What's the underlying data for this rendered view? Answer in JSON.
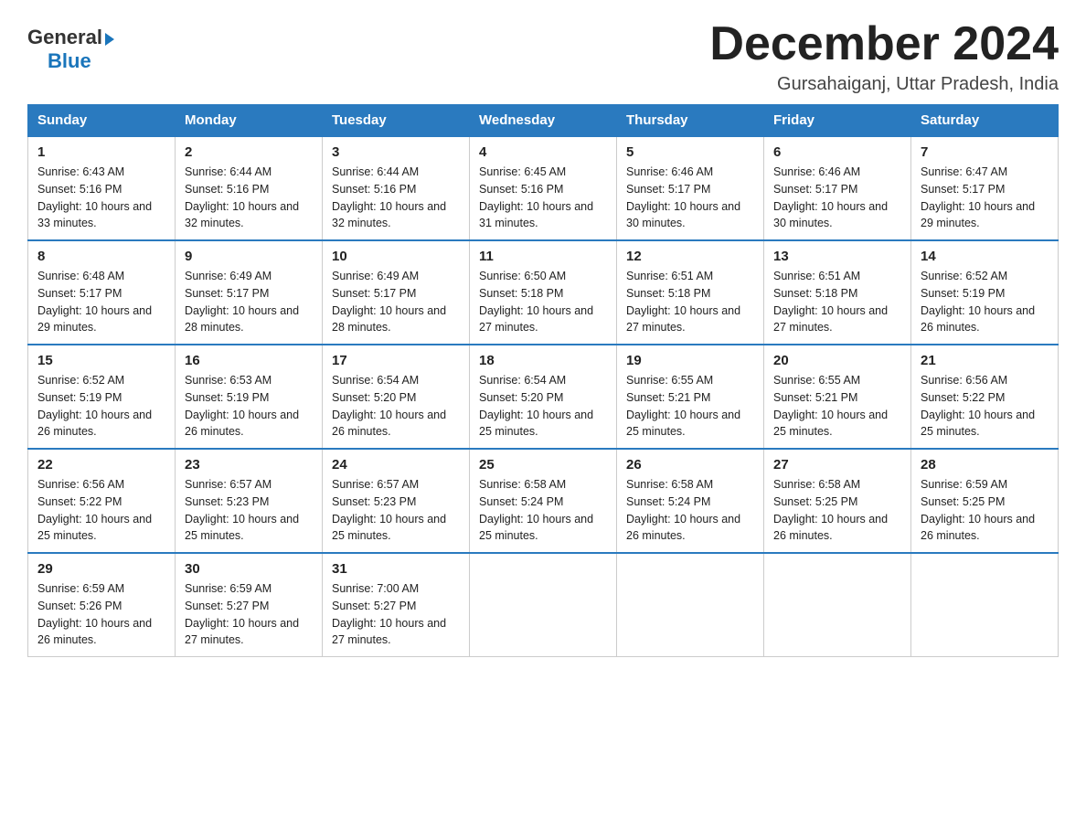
{
  "header": {
    "logo_general": "General",
    "logo_blue": "Blue",
    "title": "December 2024",
    "subtitle": "Gursahaiganj, Uttar Pradesh, India"
  },
  "days_of_week": [
    "Sunday",
    "Monday",
    "Tuesday",
    "Wednesday",
    "Thursday",
    "Friday",
    "Saturday"
  ],
  "weeks": [
    [
      {
        "day": "1",
        "sunrise": "6:43 AM",
        "sunset": "5:16 PM",
        "daylight": "10 hours and 33 minutes."
      },
      {
        "day": "2",
        "sunrise": "6:44 AM",
        "sunset": "5:16 PM",
        "daylight": "10 hours and 32 minutes."
      },
      {
        "day": "3",
        "sunrise": "6:44 AM",
        "sunset": "5:16 PM",
        "daylight": "10 hours and 32 minutes."
      },
      {
        "day": "4",
        "sunrise": "6:45 AM",
        "sunset": "5:16 PM",
        "daylight": "10 hours and 31 minutes."
      },
      {
        "day": "5",
        "sunrise": "6:46 AM",
        "sunset": "5:17 PM",
        "daylight": "10 hours and 30 minutes."
      },
      {
        "day": "6",
        "sunrise": "6:46 AM",
        "sunset": "5:17 PM",
        "daylight": "10 hours and 30 minutes."
      },
      {
        "day": "7",
        "sunrise": "6:47 AM",
        "sunset": "5:17 PM",
        "daylight": "10 hours and 29 minutes."
      }
    ],
    [
      {
        "day": "8",
        "sunrise": "6:48 AM",
        "sunset": "5:17 PM",
        "daylight": "10 hours and 29 minutes."
      },
      {
        "day": "9",
        "sunrise": "6:49 AM",
        "sunset": "5:17 PM",
        "daylight": "10 hours and 28 minutes."
      },
      {
        "day": "10",
        "sunrise": "6:49 AM",
        "sunset": "5:17 PM",
        "daylight": "10 hours and 28 minutes."
      },
      {
        "day": "11",
        "sunrise": "6:50 AM",
        "sunset": "5:18 PM",
        "daylight": "10 hours and 27 minutes."
      },
      {
        "day": "12",
        "sunrise": "6:51 AM",
        "sunset": "5:18 PM",
        "daylight": "10 hours and 27 minutes."
      },
      {
        "day": "13",
        "sunrise": "6:51 AM",
        "sunset": "5:18 PM",
        "daylight": "10 hours and 27 minutes."
      },
      {
        "day": "14",
        "sunrise": "6:52 AM",
        "sunset": "5:19 PM",
        "daylight": "10 hours and 26 minutes."
      }
    ],
    [
      {
        "day": "15",
        "sunrise": "6:52 AM",
        "sunset": "5:19 PM",
        "daylight": "10 hours and 26 minutes."
      },
      {
        "day": "16",
        "sunrise": "6:53 AM",
        "sunset": "5:19 PM",
        "daylight": "10 hours and 26 minutes."
      },
      {
        "day": "17",
        "sunrise": "6:54 AM",
        "sunset": "5:20 PM",
        "daylight": "10 hours and 26 minutes."
      },
      {
        "day": "18",
        "sunrise": "6:54 AM",
        "sunset": "5:20 PM",
        "daylight": "10 hours and 25 minutes."
      },
      {
        "day": "19",
        "sunrise": "6:55 AM",
        "sunset": "5:21 PM",
        "daylight": "10 hours and 25 minutes."
      },
      {
        "day": "20",
        "sunrise": "6:55 AM",
        "sunset": "5:21 PM",
        "daylight": "10 hours and 25 minutes."
      },
      {
        "day": "21",
        "sunrise": "6:56 AM",
        "sunset": "5:22 PM",
        "daylight": "10 hours and 25 minutes."
      }
    ],
    [
      {
        "day": "22",
        "sunrise": "6:56 AM",
        "sunset": "5:22 PM",
        "daylight": "10 hours and 25 minutes."
      },
      {
        "day": "23",
        "sunrise": "6:57 AM",
        "sunset": "5:23 PM",
        "daylight": "10 hours and 25 minutes."
      },
      {
        "day": "24",
        "sunrise": "6:57 AM",
        "sunset": "5:23 PM",
        "daylight": "10 hours and 25 minutes."
      },
      {
        "day": "25",
        "sunrise": "6:58 AM",
        "sunset": "5:24 PM",
        "daylight": "10 hours and 25 minutes."
      },
      {
        "day": "26",
        "sunrise": "6:58 AM",
        "sunset": "5:24 PM",
        "daylight": "10 hours and 26 minutes."
      },
      {
        "day": "27",
        "sunrise": "6:58 AM",
        "sunset": "5:25 PM",
        "daylight": "10 hours and 26 minutes."
      },
      {
        "day": "28",
        "sunrise": "6:59 AM",
        "sunset": "5:25 PM",
        "daylight": "10 hours and 26 minutes."
      }
    ],
    [
      {
        "day": "29",
        "sunrise": "6:59 AM",
        "sunset": "5:26 PM",
        "daylight": "10 hours and 26 minutes."
      },
      {
        "day": "30",
        "sunrise": "6:59 AM",
        "sunset": "5:27 PM",
        "daylight": "10 hours and 27 minutes."
      },
      {
        "day": "31",
        "sunrise": "7:00 AM",
        "sunset": "5:27 PM",
        "daylight": "10 hours and 27 minutes."
      },
      null,
      null,
      null,
      null
    ]
  ]
}
